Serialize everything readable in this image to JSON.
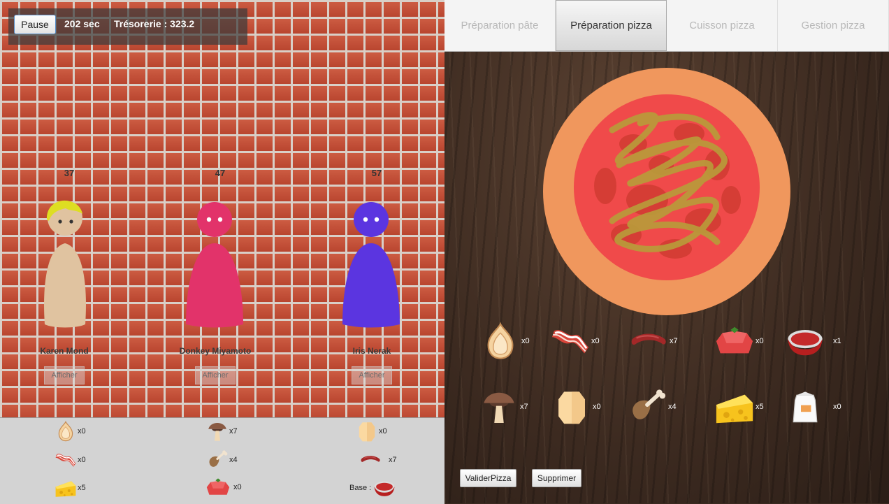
{
  "topbar": {
    "pause_label": "Pause",
    "timer": "202 sec",
    "treasury": "Trésorerie : 323.2"
  },
  "customers": [
    {
      "name": "Karen Mond",
      "score": "37",
      "button": "Afficher",
      "color": "#e0c3a0",
      "hair": "#dede22"
    },
    {
      "name": "Donkey Miyamoto",
      "score": "47",
      "button": "Afficher",
      "color": "#e2336a"
    },
    {
      "name": "Iris Nerak",
      "score": "57",
      "button": "Afficher",
      "color": "#5b35e0"
    }
  ],
  "inventory": {
    "onion": "x0",
    "mushroom": "x7",
    "dough": "x0",
    "bacon": "x0",
    "chicken": "x4",
    "sausage": "x7",
    "cheese": "x5",
    "tomato": "x0",
    "base_label": "Base :"
  },
  "tabs": [
    "Préparation pâte",
    "Préparation pizza",
    "Cuisson pizza",
    "Gestion pizza"
  ],
  "ingredients": {
    "onion": "x0",
    "bacon": "x0",
    "sausage": "x7",
    "tomato": "x0",
    "sauce": "x1",
    "mushroom": "x7",
    "dough": "x0",
    "chicken": "x4",
    "cheese": "x5",
    "flour": "x0"
  },
  "actions": {
    "validate": "ValiderPizza",
    "delete": "Supprimer"
  },
  "colors": {
    "crust": "#f0975d",
    "sauce": "#f04a4a",
    "cheese_drizzle": "#b99a3a",
    "active_tab": "#333333"
  }
}
